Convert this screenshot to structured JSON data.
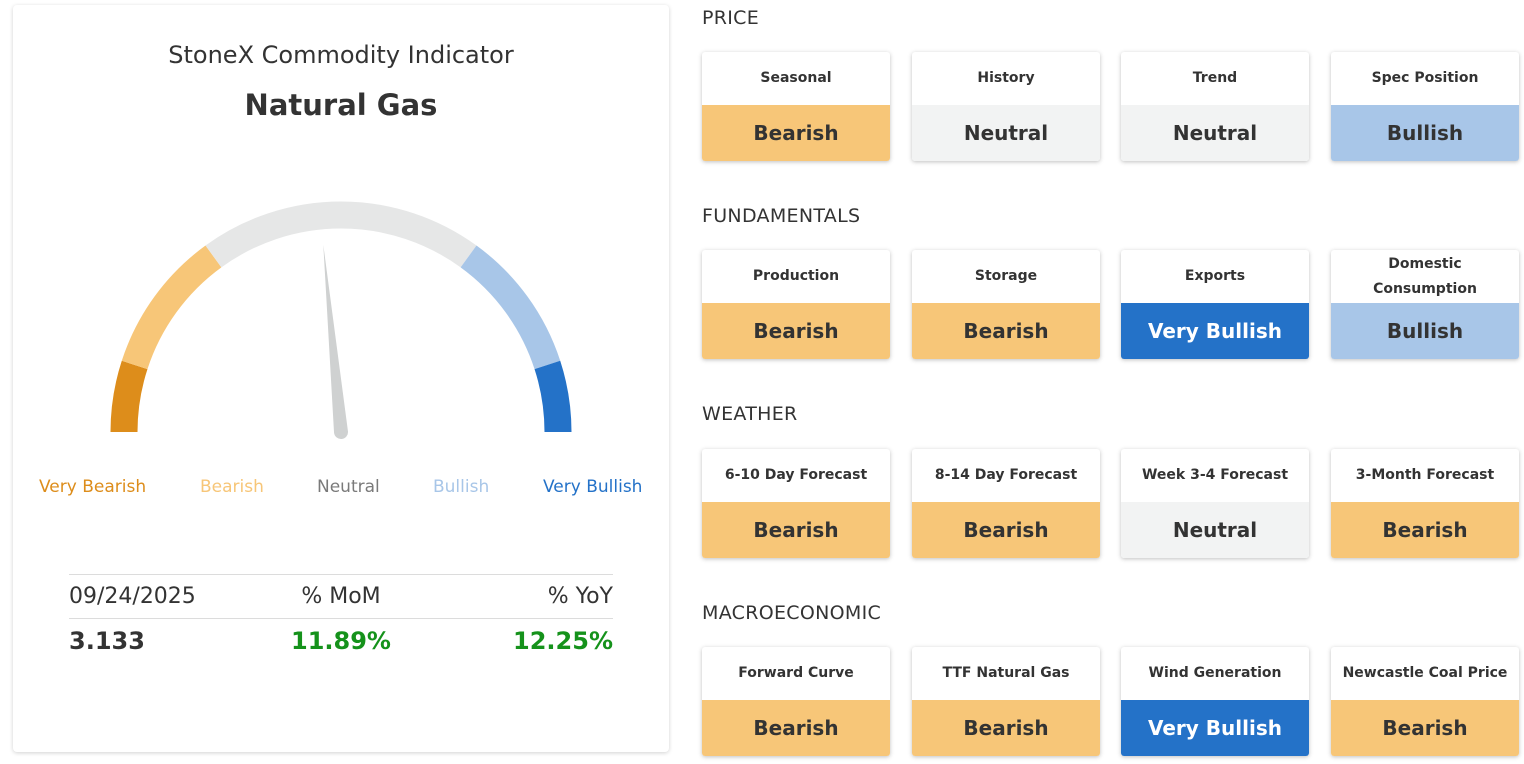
{
  "indicator": {
    "title": "StoneX Commodity Indicator",
    "commodity": "Natural Gas",
    "gauge_value": 0.47,
    "legend": [
      {
        "label": "Very Bearish",
        "color": "#dd8d1b"
      },
      {
        "label": "Bearish",
        "color": "#f7c678"
      },
      {
        "label": "Neutral",
        "color": "#7a7a7a"
      },
      {
        "label": "Bullish",
        "color": "#a8c6e8"
      },
      {
        "label": "Very Bullish",
        "color": "#2472c8"
      }
    ],
    "gauge_colors": {
      "very_bearish": "#dd8d1b",
      "bearish": "#f7c678",
      "neutral": "#e6e7e7",
      "bullish": "#a8c6e8",
      "very_bullish": "#2472c8",
      "needle": "#cfd1d1"
    },
    "stats": {
      "date": "09/24/2025",
      "mom_label": "% MoM",
      "yoy_label": "% YoY",
      "price": "3.133",
      "mom": "11.89%",
      "yoy": "12.25%"
    }
  },
  "sections": [
    {
      "title": "PRICE",
      "cards": [
        {
          "label": "Seasonal",
          "value": "Bearish",
          "signal": "bearish"
        },
        {
          "label": "History",
          "value": "Neutral",
          "signal": "neutral"
        },
        {
          "label": "Trend",
          "value": "Neutral",
          "signal": "neutral"
        },
        {
          "label": "Spec Position",
          "value": "Bullish",
          "signal": "bullish"
        }
      ]
    },
    {
      "title": "FUNDAMENTALS",
      "cards": [
        {
          "label": "Production",
          "value": "Bearish",
          "signal": "bearish"
        },
        {
          "label": "Storage",
          "value": "Bearish",
          "signal": "bearish"
        },
        {
          "label": "Exports",
          "value": "Very Bullish",
          "signal": "vbullish"
        },
        {
          "label": "Domestic Consumption",
          "value": "Bullish",
          "signal": "bullish"
        }
      ]
    },
    {
      "title": "WEATHER",
      "cards": [
        {
          "label": "6-10 Day Forecast",
          "value": "Bearish",
          "signal": "bearish"
        },
        {
          "label": "8-14 Day Forecast",
          "value": "Bearish",
          "signal": "bearish"
        },
        {
          "label": "Week 3-4 Forecast",
          "value": "Neutral",
          "signal": "neutral"
        },
        {
          "label": "3-Month Forecast",
          "value": "Bearish",
          "signal": "bearish"
        }
      ]
    },
    {
      "title": "MACROECONOMIC",
      "cards": [
        {
          "label": "Forward Curve",
          "value": "Bearish",
          "signal": "bearish"
        },
        {
          "label": "TTF Natural Gas",
          "value": "Bearish",
          "signal": "bearish"
        },
        {
          "label": "Wind Generation",
          "value": "Very Bullish",
          "signal": "vbullish"
        },
        {
          "label": "Newcastle Coal Price",
          "value": "Bearish",
          "signal": "bearish"
        }
      ]
    }
  ]
}
